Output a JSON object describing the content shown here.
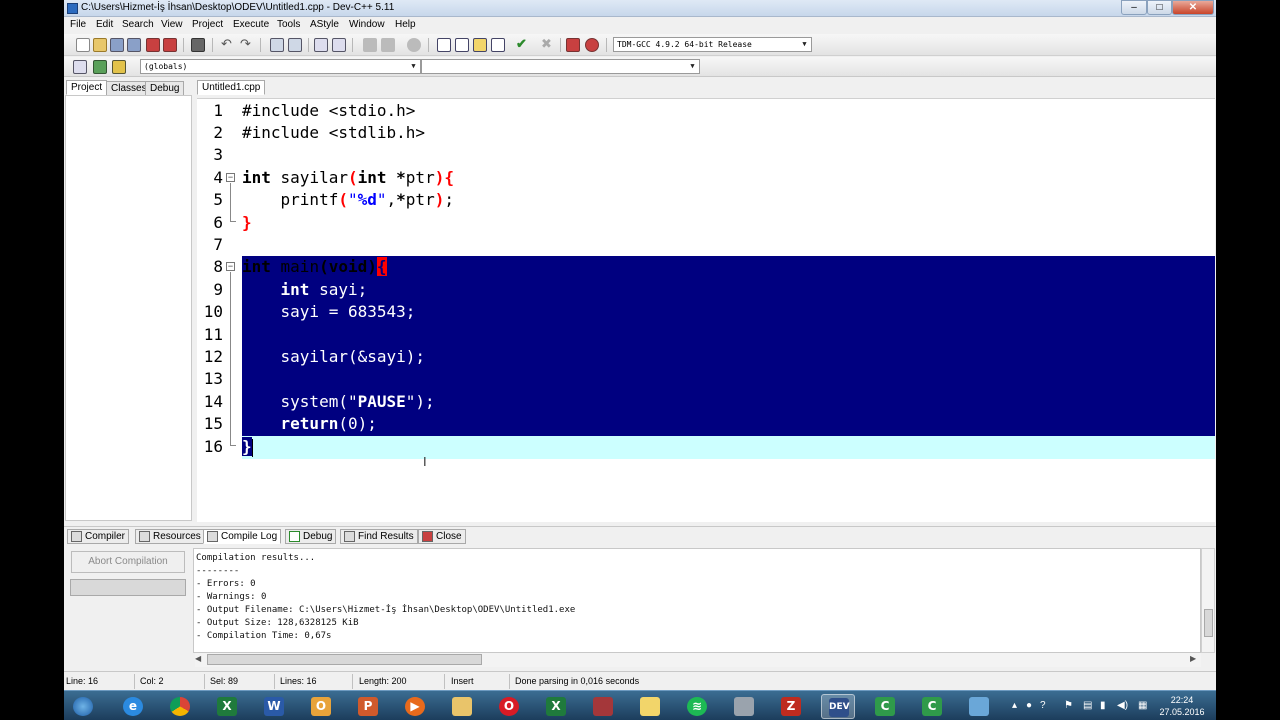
{
  "window": {
    "title": "C:\\Users\\Hizmet-İş İhsan\\Desktop\\ODEV\\Untitled1.cpp - Dev-C++ 5.11",
    "controls": {
      "minimize": "–",
      "maximize": "□",
      "close": "✕"
    }
  },
  "menu": [
    "File",
    "Edit",
    "Search",
    "View",
    "Project",
    "Execute",
    "Tools",
    "AStyle",
    "Window",
    "Help"
  ],
  "toolbar": {
    "compiler": "TDM-GCC 4.9.2 64-bit Release",
    "scope": "(globals)",
    "member": ""
  },
  "left_tabs": [
    "Project",
    "Classes",
    "Debug"
  ],
  "editor": {
    "file_tab": "Untitled1.cpp",
    "line_numbers": [
      "1",
      "2",
      "3",
      "4",
      "5",
      "6",
      "7",
      "8",
      "9",
      "10",
      "11",
      "12",
      "13",
      "14",
      "15",
      "16"
    ]
  },
  "bottom_tabs": [
    "Compiler",
    "Resources",
    "Compile Log",
    "Debug",
    "Find Results",
    "Close"
  ],
  "compile_log": {
    "abort_button": "Abort Compilation",
    "lines": [
      "Compilation results...",
      "--------",
      "- Errors: 0",
      "- Warnings: 0",
      "- Output Filename: C:\\Users\\Hizmet-İş İhsan\\Desktop\\ODEV\\Untitled1.exe",
      "- Output Size: 128,6328125 KiB",
      "- Compilation Time: 0,67s"
    ]
  },
  "status": {
    "line": "Line:  16",
    "col": "Col:   2",
    "sel": "Sel:   89",
    "lines": "Lines:   16",
    "length": "Length:  200",
    "mode": "Insert",
    "message": "Done parsing in 0,016 seconds"
  },
  "taskbar": {
    "apps": [
      "start-orb",
      "internet-explorer",
      "chrome",
      "excel",
      "word",
      "outlook",
      "powerpoint",
      "media-player",
      "file-explorer",
      "opera",
      "excel-2",
      "access",
      "sticky-notes",
      "spotify",
      "drive-manager",
      "filezilla",
      "dev-cpp",
      "camtasia",
      "camtasia-2",
      "paint"
    ],
    "clock_time": "22:24",
    "clock_date": "27.05.2016"
  }
}
